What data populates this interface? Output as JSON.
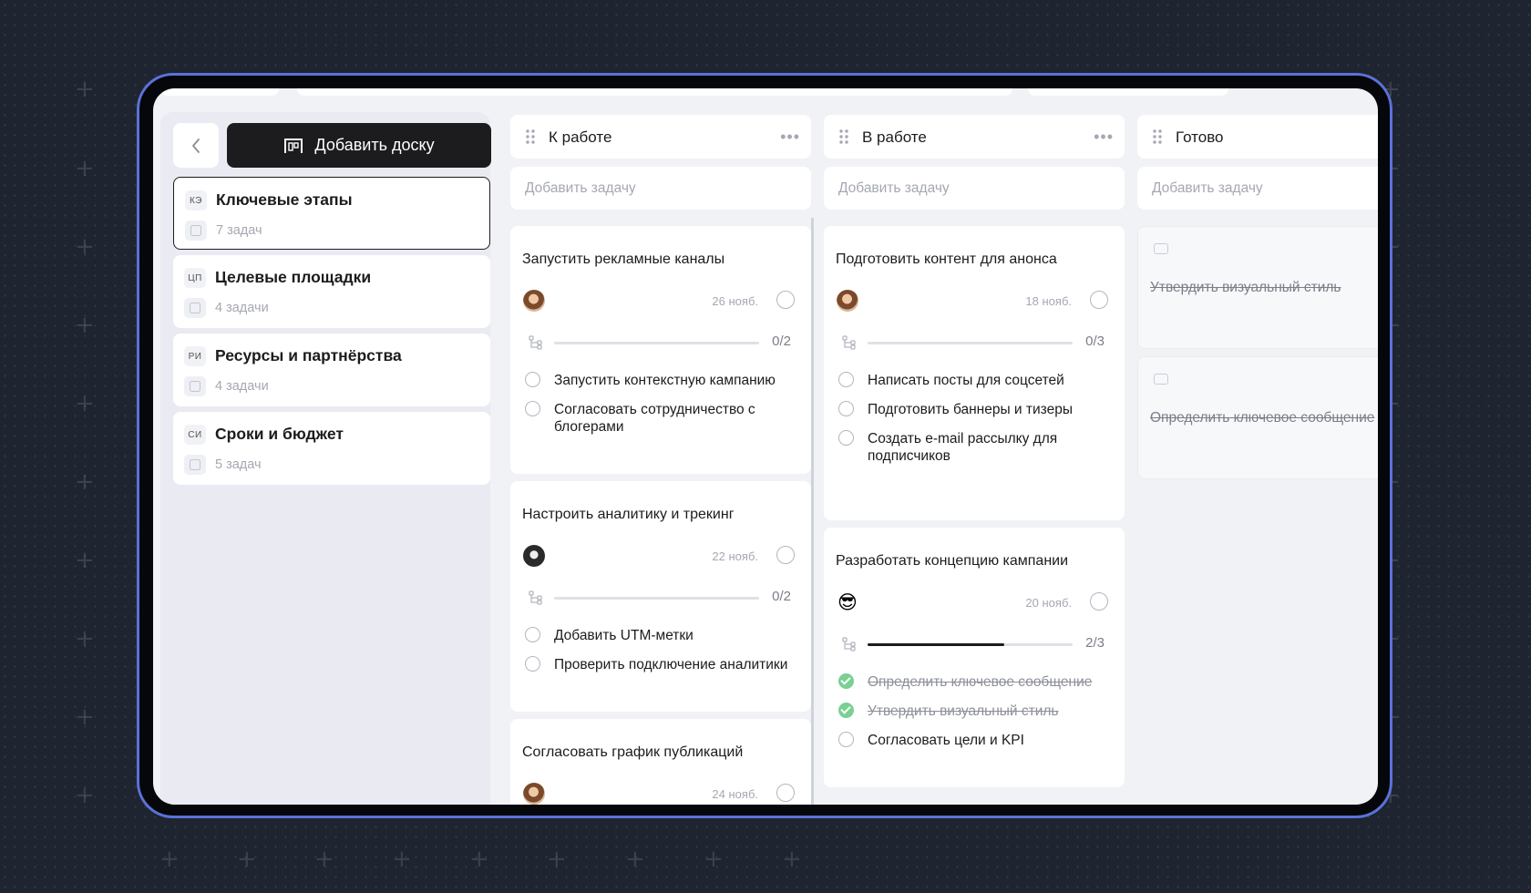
{
  "sidebar": {
    "add_board_label": "Добавить доску",
    "boards": [
      {
        "abbr": "КЭ",
        "name": "Ключевые этапы",
        "count": "7 задач",
        "active": true
      },
      {
        "abbr": "ЦП",
        "name": "Целевые площадки",
        "count": "4 задачи"
      },
      {
        "abbr": "РИ",
        "name": "Ресурсы и партнёрства",
        "count": "4 задачи"
      },
      {
        "abbr": "СИ",
        "name": "Сроки и бюджет",
        "count": "5 задач"
      }
    ]
  },
  "columns": [
    {
      "title": "К работе",
      "add_task": "Добавить задачу",
      "cards": [
        {
          "title": "Запустить рекламные каналы",
          "date": "26 нояб.",
          "avatar": "beige",
          "progress": "0/2",
          "progress_value": 0,
          "subtasks": [
            {
              "text": "Запустить контекстную кампанию",
              "done": false
            },
            {
              "text": "Согласовать сотрудничество с блогерами",
              "done": false
            }
          ]
        },
        {
          "title": "Настроить аналитику и трекинг",
          "date": "22 нояб.",
          "avatar": "dark",
          "progress": "0/2",
          "progress_value": 0,
          "subtasks": [
            {
              "text": "Добавить UTM-метки",
              "done": false
            },
            {
              "text": "Проверить подключение аналитики",
              "done": false
            }
          ]
        },
        {
          "title": "Согласовать график публикаций",
          "date": "24 нояб.",
          "avatar": "beige"
        }
      ]
    },
    {
      "title": "В работе",
      "add_task": "Добавить задачу",
      "cards": [
        {
          "title": "Подготовить контент для анонса",
          "date": "18 нояб.",
          "avatar": "beige",
          "progress": "0/3",
          "progress_value": 0,
          "subtasks": [
            {
              "text": "Написать посты для соцсетей",
              "done": false
            },
            {
              "text": "Подготовить баннеры и тизеры",
              "done": false
            },
            {
              "text": "Создать e-mail рассылку для подписчиков",
              "done": false
            }
          ]
        },
        {
          "title": "Разработать концепцию кампании",
          "date": "20 нояб.",
          "avatar": "emoji",
          "avatar_emoji": "😎",
          "progress": "2/3",
          "progress_value": 0.667,
          "subtasks": [
            {
              "text": "Определить ключевое сообщение",
              "done": true
            },
            {
              "text": "Утвердить визуальный стиль",
              "done": true
            },
            {
              "text": "Согласовать цели и KPI",
              "done": false
            }
          ]
        }
      ]
    },
    {
      "title": "Готово",
      "add_task": "Добавить задачу",
      "done_cards": [
        {
          "title": "Утвердить визуальный стиль"
        },
        {
          "title": "Определить ключевое сообщение"
        }
      ]
    }
  ]
}
